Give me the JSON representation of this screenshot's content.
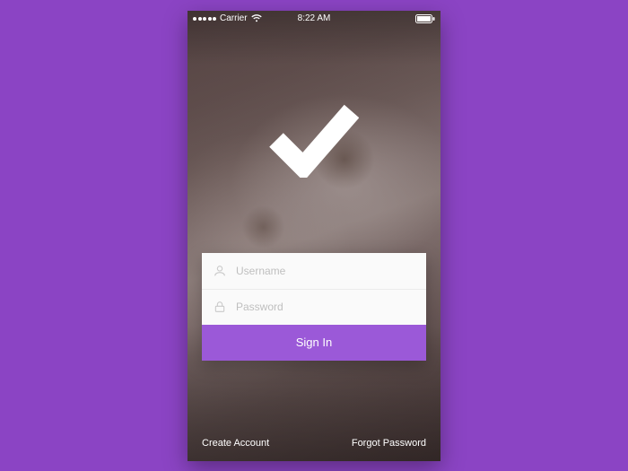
{
  "colors": {
    "page_bg": "#8b44c4",
    "accent": "#9b59d8",
    "card_bg": "#fafafa",
    "placeholder": "#bfbfbf"
  },
  "status_bar": {
    "carrier": "Carrier",
    "time": "8:22 AM"
  },
  "logo": {
    "name": "checkmark"
  },
  "form": {
    "username": {
      "placeholder": "Username",
      "value": "",
      "icon": "user-icon"
    },
    "password": {
      "placeholder": "Password",
      "value": "",
      "icon": "lock-icon"
    },
    "signin_label": "Sign In"
  },
  "footer": {
    "create_account": "Create Account",
    "forgot_password": "Forgot Password"
  }
}
